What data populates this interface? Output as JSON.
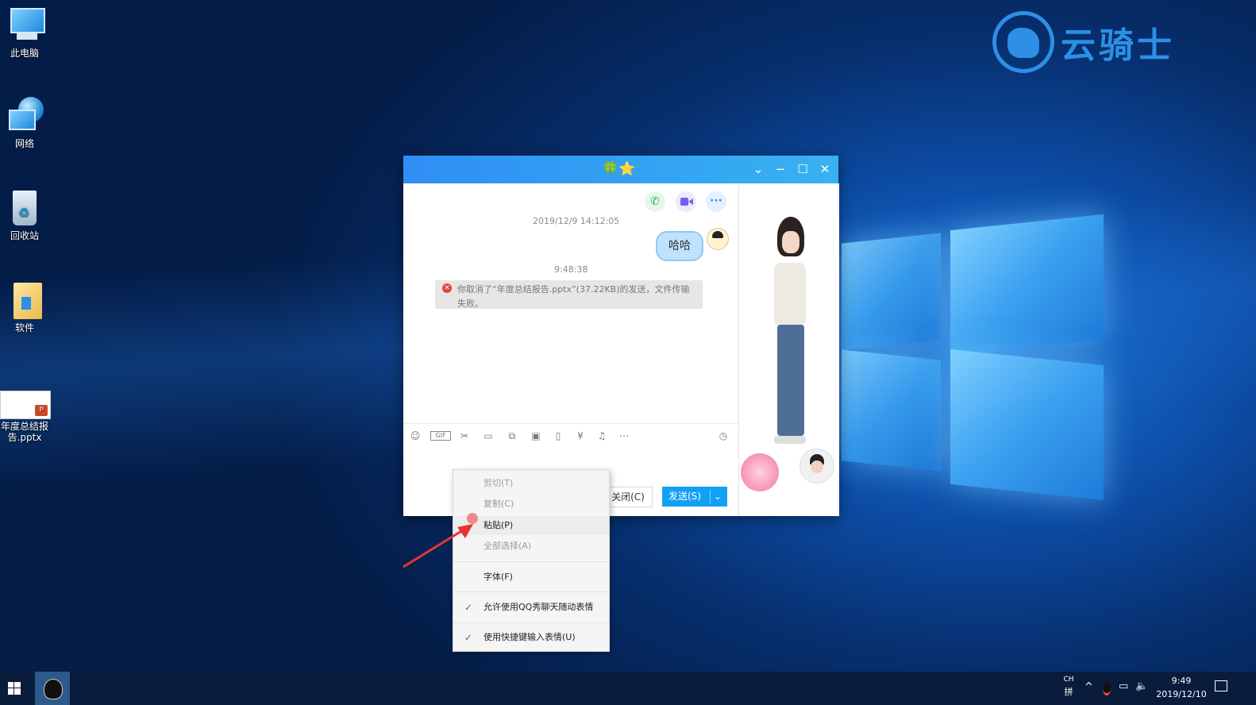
{
  "desktop": {
    "icons": [
      {
        "label": "此电脑"
      },
      {
        "label": "网络"
      },
      {
        "label": "回收站"
      },
      {
        "label": "软件"
      },
      {
        "label": "年度总结报告.pptx"
      }
    ]
  },
  "brand": {
    "text": "云骑士"
  },
  "qq_window": {
    "title_icons": "🍀⭐",
    "chat": {
      "timestamp1": "2019/12/9 14:12:05",
      "bubble_text": "哈哈",
      "timestamp2": "9:48:38",
      "notice_text": "你取消了“年度总结报告.pptx”(37.22KB)的发送，文件传输失败。"
    },
    "toolbar_icons": [
      "emoji-icon",
      "gif-icon",
      "scissors-icon",
      "folder-icon",
      "screenshot-icon",
      "image-icon",
      "vibrate-icon",
      "red-packet-icon",
      "music-icon",
      "more-icon",
      "history-icon"
    ],
    "close_button": "关闭(C)",
    "send_button": "发送(S)"
  },
  "context_menu": {
    "items": [
      {
        "label": "剪切(T)",
        "enabled": false
      },
      {
        "label": "复制(C)",
        "enabled": false
      },
      {
        "label": "粘贴(P)",
        "enabled": true
      },
      {
        "label": "全部选择(A)",
        "enabled": false
      },
      {
        "label": "字体(F)",
        "enabled": true
      },
      {
        "label": "允许使用QQ秀聊天随动表情",
        "enabled": true,
        "checked": true
      },
      {
        "label": "使用快捷键输入表情(U)",
        "enabled": true,
        "checked": true
      }
    ]
  },
  "taskbar": {
    "ime_top": "CH",
    "ime_bottom": "拼",
    "time": "9:49",
    "date": "2019/12/10"
  },
  "colors": {
    "title_bar": "#2f8ef5",
    "send_button": "#12a0f5",
    "error": "#e8413c"
  }
}
